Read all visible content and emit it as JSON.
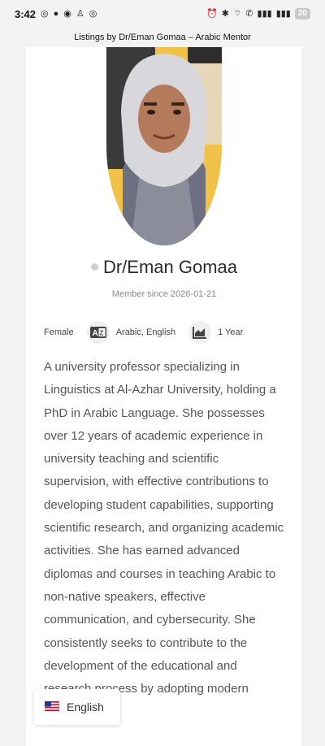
{
  "status_bar": {
    "time": "3:42",
    "battery": "20"
  },
  "page": {
    "title": "Listings by Dr/Eman Gomaa – Arabic Mentor"
  },
  "profile": {
    "name": "Dr/Eman Gomaa",
    "member_since": "Member since 2026-01-21",
    "gender": "Female",
    "languages": "Arabic, English",
    "experience": "1 Year",
    "bio": "A university professor specializing in Linguistics at Al-Azhar University, holding a PhD in Arabic Language. She possesses over 12 years of academic experience in university teaching and scientific supervision, with effective contributions to developing student capabilities, supporting scientific research, and organizing academic activities. She has earned advanced diplomas and courses in teaching Arabic to non-native speakers, effective communication, and cybersecurity. She consistently seeks to contribute to the development of the educational and research process by adopting modern strategies and"
  },
  "language_switcher": {
    "label": "English"
  },
  "icons": {
    "languages": "translate-icon",
    "experience": "chart-icon",
    "flag": "us-flag-icon"
  }
}
